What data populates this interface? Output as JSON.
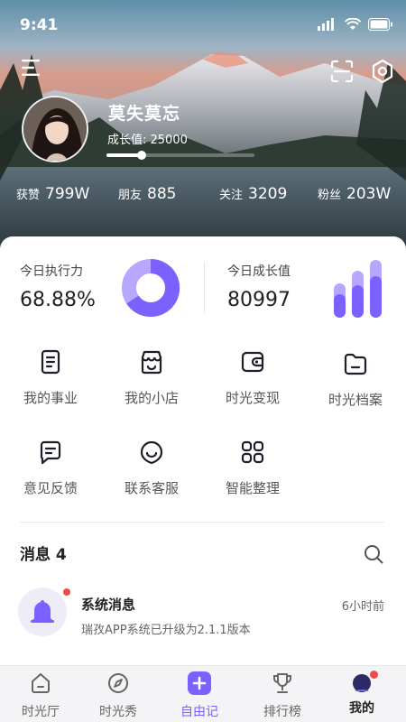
{
  "status_bar": {
    "time": "9:41"
  },
  "profile": {
    "name": "莫失莫忘",
    "growth_label": "成长值: 25000",
    "growth_progress": 0.24
  },
  "stats": [
    {
      "label": "获赞",
      "value": "799W"
    },
    {
      "label": "朋友",
      "value": "885"
    },
    {
      "label": "关注",
      "value": "3209"
    },
    {
      "label": "粉丝",
      "value": "203W"
    }
  ],
  "metrics": {
    "execution": {
      "title": "今日执行力",
      "value": "68.88%"
    },
    "growth": {
      "title": "今日成长值",
      "value": "80997"
    }
  },
  "features": [
    {
      "label": "我的事业",
      "icon": "document-icon"
    },
    {
      "label": "我的小店",
      "icon": "shop-icon"
    },
    {
      "label": "时光变现",
      "icon": "wallet-icon"
    },
    {
      "label": "时光档案",
      "icon": "folder-icon"
    },
    {
      "label": "意见反馈",
      "icon": "chat-icon"
    },
    {
      "label": "联系客服",
      "icon": "customer-service-icon"
    },
    {
      "label": "智能整理",
      "icon": "grid-icon"
    }
  ],
  "messages": {
    "title": "消息 4",
    "items": [
      {
        "name": "系统消息",
        "time": "6小时前",
        "text": "瑞孜APP系统已升级为2.1.1版本"
      }
    ]
  },
  "tabbar": [
    {
      "label": "时光厅",
      "icon": "home-icon"
    },
    {
      "label": "时光秀",
      "icon": "compass-icon"
    },
    {
      "label": "自由记",
      "icon": "plus-icon"
    },
    {
      "label": "排行榜",
      "icon": "trophy-icon"
    },
    {
      "label": "我的",
      "icon": "profile-icon"
    }
  ],
  "colors": {
    "accent": "#7b61ff",
    "accent_light": "#b8a6ff",
    "badge": "#ef4b4b"
  }
}
